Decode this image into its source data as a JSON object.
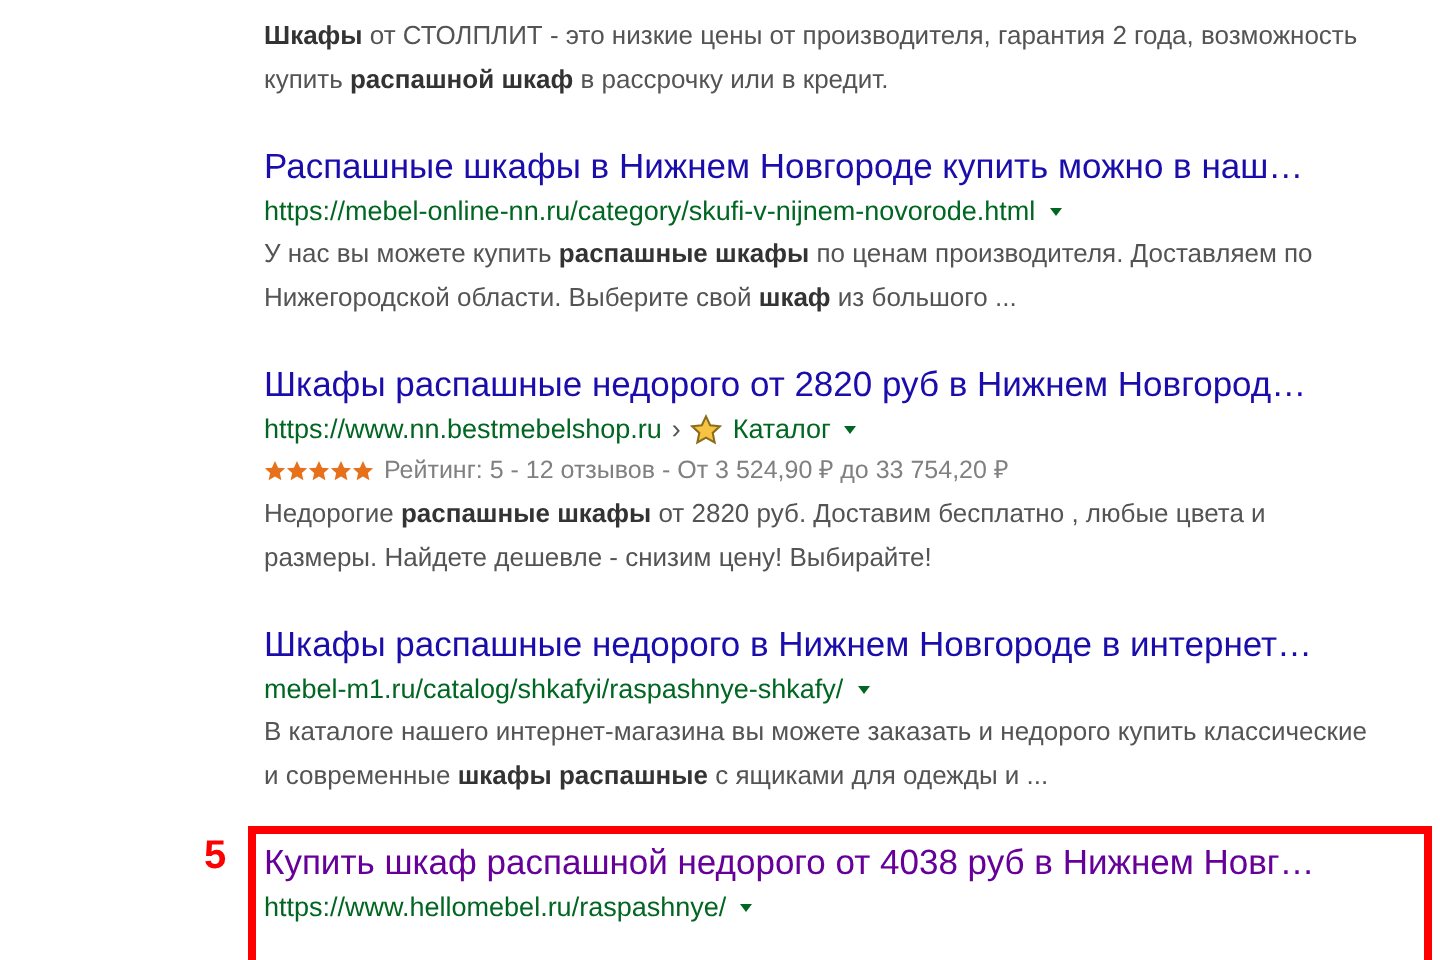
{
  "results": [
    {
      "snippet": "**Шкафы** от СТОЛПЛИТ - это низкие цены от производителя, гарантия 2 года, возможность купить **распашной шкаф** в рассрочку или в кредит."
    },
    {
      "title": "Распашные шкафы в Нижнем Новгороде купить можно в наш…",
      "visited": false,
      "url": "https://mebel-online-nn.ru/category/skufi-v-nijnem-novorode.html",
      "snippet": "У нас вы можете купить **распашные шкафы** по ценам производителя. Доставляем по Нижегородской области. Выберите свой **шкаф** из большого ..."
    },
    {
      "title": "Шкафы распашные недорого от 2820 руб в Нижнем Новгород…",
      "visited": false,
      "url": "https://www.nn.bestmebelshop.ru",
      "separator": "›",
      "breadcrumb": "Каталог",
      "stars": 5,
      "rating_text": "Рейтинг: 5 - 12 отзывов - От 3 524,90 ₽ до 33 754,20 ₽",
      "snippet": "Недорогие **распашные шкафы** от 2820 руб. Доставим бесплатно , любые цвета и размеры. Найдете дешевле - снизим цену! Выбирайте!"
    },
    {
      "title": "Шкафы распашные недорого в Нижнем Новгороде в интернет…",
      "visited": false,
      "url": "mebel-m1.ru/catalog/shkafyi/raspashnye-shkafy/",
      "snippet": "В каталоге нашего интернет-магазина вы можете заказать и недорого купить классические и современные **шкафы распашные** с ящиками для одежды и ..."
    },
    {
      "title": "Купить шкаф распашной недорого от 4038 руб в Нижнем Новг…",
      "visited": true,
      "url": "https://www.hellomebel.ru/raspashnye/",
      "highlighted": true,
      "marker": "5"
    }
  ]
}
